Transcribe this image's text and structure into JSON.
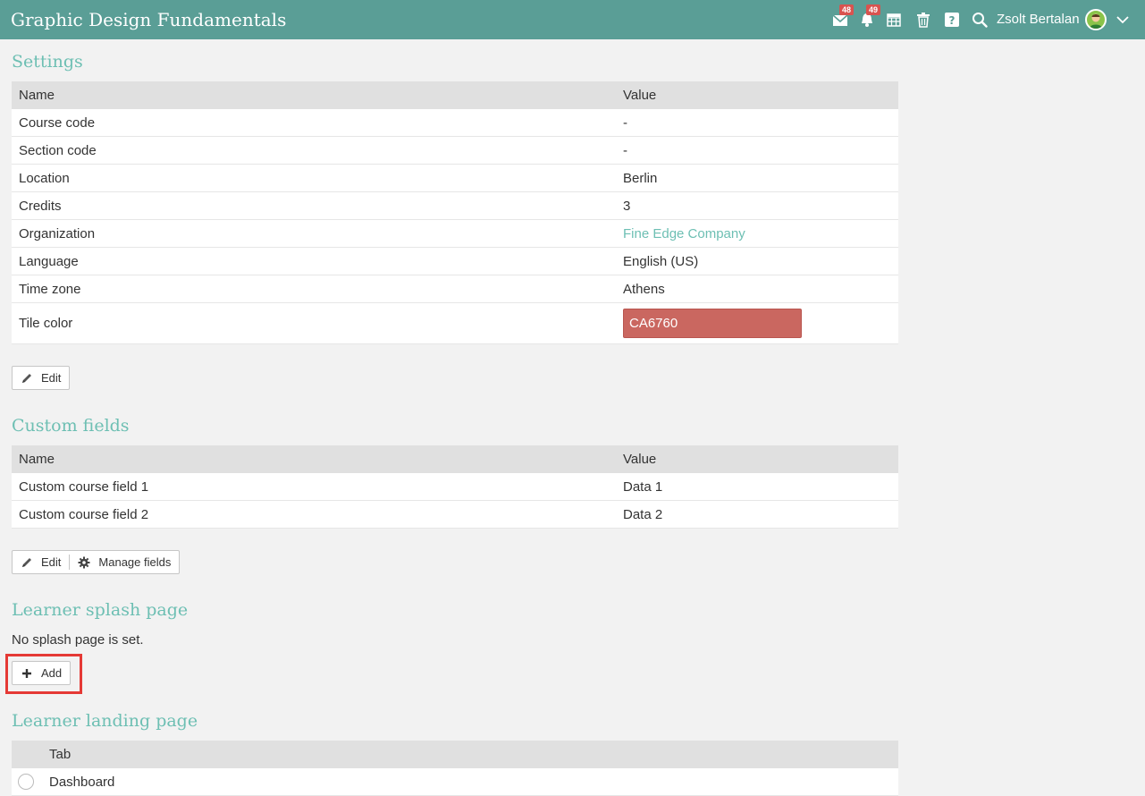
{
  "header": {
    "app_title": "Graphic Design Fundamentals",
    "messages_badge": "48",
    "notifications_badge": "49",
    "username": "Zsolt Bertalan",
    "icons": [
      "mail-icon",
      "bell-icon",
      "calendar-icon",
      "trash-icon",
      "help-icon",
      "search-icon",
      "avatar",
      "chevron-down-icon"
    ]
  },
  "settings": {
    "title": "Settings",
    "columns": [
      "Name",
      "Value"
    ],
    "rows": [
      {
        "name": "Course code",
        "value": "-"
      },
      {
        "name": "Section code",
        "value": "-"
      },
      {
        "name": "Location",
        "value": "Berlin"
      },
      {
        "name": "Credits",
        "value": "3"
      },
      {
        "name": "Organization",
        "value": "Fine Edge Company"
      },
      {
        "name": "Language",
        "value": "English (US)"
      },
      {
        "name": "Time zone",
        "value": "Athens"
      },
      {
        "name": "Tile color",
        "value": "CA6760"
      }
    ],
    "tile_color_hex": "#ca6760",
    "edit_label": "Edit"
  },
  "custom_fields": {
    "title": "Custom fields",
    "columns": [
      "Name",
      "Value"
    ],
    "rows": [
      {
        "name": "Custom course field 1",
        "value": "Data 1"
      },
      {
        "name": "Custom course field 2",
        "value": "Data 2"
      }
    ],
    "edit_label": "Edit",
    "manage_label": "Manage fields"
  },
  "splash": {
    "title": "Learner splash page",
    "empty_text": "No splash page is set.",
    "add_label": "Add"
  },
  "landing": {
    "title": "Learner landing page",
    "column": "Tab",
    "rows": [
      {
        "label": "Dashboard"
      }
    ]
  },
  "colors": {
    "header_bg": "#5a9e96",
    "accent": "#6dbfb3",
    "badge": "#d9534f",
    "highlight_border": "#e53935"
  }
}
